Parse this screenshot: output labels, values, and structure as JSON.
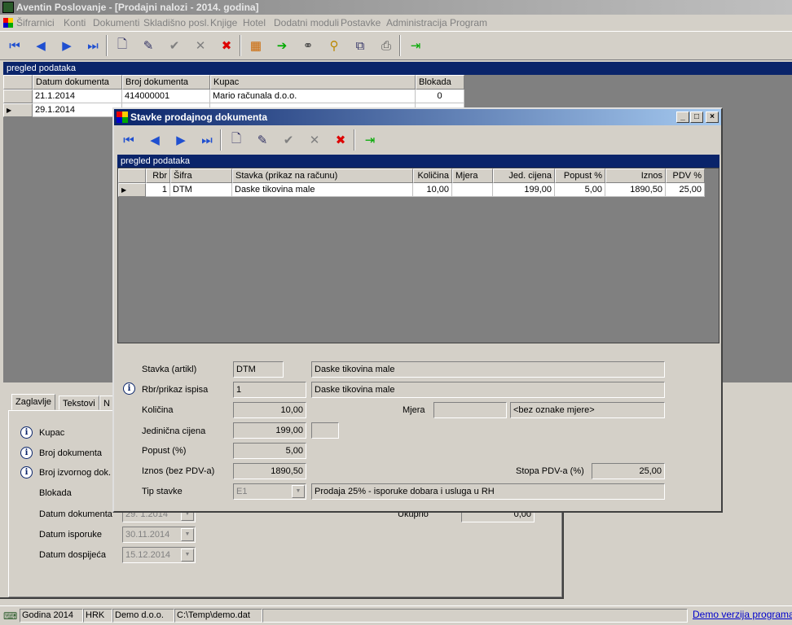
{
  "app": {
    "title": "Aventin Poslovanje - [Prodajni nalozi - 2014. godina]"
  },
  "menu": [
    "Šifrarnici",
    "Konti",
    "Dokumenti",
    "Skladišno posl.",
    "Knjige",
    "Hotel",
    "Dodatni moduli",
    "Postavke",
    "Administracija",
    "Program"
  ],
  "main": {
    "section_title": "pregled podataka",
    "columns": [
      "Datum dokumenta",
      "Broj dokumenta",
      "Kupac",
      "Blokada"
    ],
    "rows": [
      {
        "datum": "21.1.2014",
        "broj": "414000001",
        "kupac": "Mario računala d.o.o.",
        "blokada": "0"
      },
      {
        "datum": "29.1.2014",
        "broj": "",
        "kupac": "",
        "blokada": ""
      }
    ],
    "tabs": [
      "Zaglavlje",
      "Tekstovi",
      "N"
    ],
    "form_labels": {
      "kupac": "Kupac",
      "broj_dokumenta": "Broj dokumenta",
      "broj_izvornog": "Broj izvornog dok.",
      "blokada": "Blokada",
      "datum_dokumenta": "Datum dokumenta",
      "datum_isporuke": "Datum isporuke",
      "datum_dospijeca": "Datum dospijeća",
      "ukupno": "Ukupno"
    },
    "form_values": {
      "datum_dokumenta": "29. 1.2014",
      "datum_isporuke": "30.11.2014",
      "datum_dospijeca": "15.12.2014",
      "ukupno": "0,00"
    }
  },
  "dialog": {
    "title": "Stavke prodajnog dokumenta",
    "section_title": "pregled podataka",
    "columns": [
      "Rbr",
      "Šifra",
      "Stavka (prikaz na računu)",
      "Količina",
      "Mjera",
      "Jed. cijena",
      "Popust %",
      "Iznos",
      "PDV %"
    ],
    "rows": [
      {
        "rbr": "1",
        "sifra": "DTM",
        "stavka": "Daske tikovina male",
        "kolicina": "10,00",
        "mjera": "",
        "cijena": "199,00",
        "popust": "5,00",
        "iznos": "1890,50",
        "pdv": "25,00"
      }
    ],
    "labels": {
      "stavka": "Stavka (artikl)",
      "rbr": "Rbr/prikaz ispisa",
      "kolicina": "Količina",
      "mjera": "Mjera",
      "cijena": "Jedinična cijena",
      "popust": "Popust (%)",
      "iznos": "Iznos (bez PDV-a)",
      "stopa": "Stopa PDV-a (%)",
      "tip": "Tip stavke"
    },
    "values": {
      "stavka_code": "DTM",
      "stavka_name": "Daske tikovina male",
      "rbr": "1",
      "rbr_name": "Daske tikovina male",
      "kolicina": "10,00",
      "mjera_code": "",
      "mjera_name": "<bez oznake mjere>",
      "cijena": "199,00",
      "popust": "5,00",
      "iznos": "1890,50",
      "stopa": "25,00",
      "tip_code": "E1",
      "tip_name": "Prodaja 25% - isporuke dobara i usluga u RH"
    }
  },
  "status": {
    "godina": "Godina 2014",
    "valuta": "HRK",
    "tvrtka": "Demo d.o.o.",
    "path": "C:\\Temp\\demo.dat",
    "demo": "Demo verzija programa Po"
  }
}
